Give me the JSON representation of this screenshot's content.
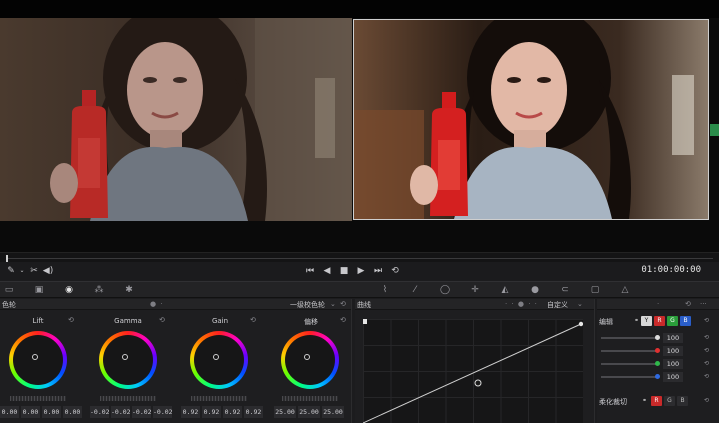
{
  "colors": {
    "accent": "#ff3b30",
    "panel_bg": "#1e1e20",
    "viewer_bg": "#0a0a0a"
  },
  "transport": {
    "timecode": "01:00:00:00",
    "left_tools": [
      "pen-icon",
      "chevron-down-icon",
      "scissors-icon",
      "speaker-icon"
    ],
    "buttons": [
      "skip-start-icon",
      "step-back-icon",
      "stop-icon",
      "play-icon",
      "skip-end-icon",
      "loop-icon"
    ]
  },
  "wheels_panel": {
    "title": "色轮",
    "mode": "一级校色轮",
    "wheels": [
      {
        "label": "Lift",
        "values": [
          "0.00",
          "0.00",
          "0.00",
          "0.00"
        ]
      },
      {
        "label": "Gamma",
        "values": [
          "-0.02",
          "-0.02",
          "-0.02",
          "-0.02"
        ]
      },
      {
        "label": "Gain",
        "values": [
          "0.92",
          "0.92",
          "0.92",
          "0.92"
        ]
      },
      {
        "label": "偏移",
        "values": [
          "25.00",
          "25.00",
          "25.00"
        ]
      }
    ]
  },
  "curves_panel": {
    "title": "曲线",
    "mode": "自定义"
  },
  "edit_panel": {
    "title": "编辑",
    "channel_chips": [
      "Y",
      "R",
      "G",
      "B"
    ],
    "rows": [
      {
        "value": "100",
        "color": "#dcdcdc"
      },
      {
        "value": "100",
        "color": "#e03030"
      },
      {
        "value": "100",
        "color": "#2fb84a"
      },
      {
        "value": "100",
        "color": "#2f6ae0"
      }
    ],
    "soft_clip_label": "柔化裁切",
    "soft_chips": [
      "R",
      "G",
      "B"
    ]
  }
}
